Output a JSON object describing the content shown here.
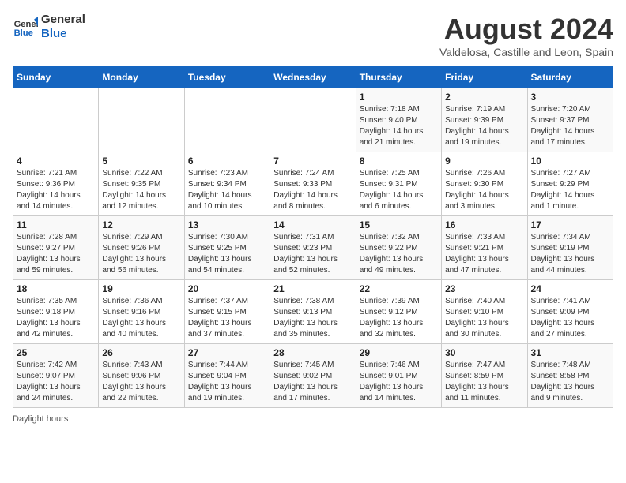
{
  "header": {
    "logo_line1": "General",
    "logo_line2": "Blue",
    "month_year": "August 2024",
    "location": "Valdelosa, Castille and Leon, Spain"
  },
  "calendar": {
    "days_of_week": [
      "Sunday",
      "Monday",
      "Tuesday",
      "Wednesday",
      "Thursday",
      "Friday",
      "Saturday"
    ],
    "weeks": [
      [
        {
          "day": "",
          "info": ""
        },
        {
          "day": "",
          "info": ""
        },
        {
          "day": "",
          "info": ""
        },
        {
          "day": "",
          "info": ""
        },
        {
          "day": "1",
          "info": "Sunrise: 7:18 AM\nSunset: 9:40 PM\nDaylight: 14 hours and 21 minutes."
        },
        {
          "day": "2",
          "info": "Sunrise: 7:19 AM\nSunset: 9:39 PM\nDaylight: 14 hours and 19 minutes."
        },
        {
          "day": "3",
          "info": "Sunrise: 7:20 AM\nSunset: 9:37 PM\nDaylight: 14 hours and 17 minutes."
        }
      ],
      [
        {
          "day": "4",
          "info": "Sunrise: 7:21 AM\nSunset: 9:36 PM\nDaylight: 14 hours and 14 minutes."
        },
        {
          "day": "5",
          "info": "Sunrise: 7:22 AM\nSunset: 9:35 PM\nDaylight: 14 hours and 12 minutes."
        },
        {
          "day": "6",
          "info": "Sunrise: 7:23 AM\nSunset: 9:34 PM\nDaylight: 14 hours and 10 minutes."
        },
        {
          "day": "7",
          "info": "Sunrise: 7:24 AM\nSunset: 9:33 PM\nDaylight: 14 hours and 8 minutes."
        },
        {
          "day": "8",
          "info": "Sunrise: 7:25 AM\nSunset: 9:31 PM\nDaylight: 14 hours and 6 minutes."
        },
        {
          "day": "9",
          "info": "Sunrise: 7:26 AM\nSunset: 9:30 PM\nDaylight: 14 hours and 3 minutes."
        },
        {
          "day": "10",
          "info": "Sunrise: 7:27 AM\nSunset: 9:29 PM\nDaylight: 14 hours and 1 minute."
        }
      ],
      [
        {
          "day": "11",
          "info": "Sunrise: 7:28 AM\nSunset: 9:27 PM\nDaylight: 13 hours and 59 minutes."
        },
        {
          "day": "12",
          "info": "Sunrise: 7:29 AM\nSunset: 9:26 PM\nDaylight: 13 hours and 56 minutes."
        },
        {
          "day": "13",
          "info": "Sunrise: 7:30 AM\nSunset: 9:25 PM\nDaylight: 13 hours and 54 minutes."
        },
        {
          "day": "14",
          "info": "Sunrise: 7:31 AM\nSunset: 9:23 PM\nDaylight: 13 hours and 52 minutes."
        },
        {
          "day": "15",
          "info": "Sunrise: 7:32 AM\nSunset: 9:22 PM\nDaylight: 13 hours and 49 minutes."
        },
        {
          "day": "16",
          "info": "Sunrise: 7:33 AM\nSunset: 9:21 PM\nDaylight: 13 hours and 47 minutes."
        },
        {
          "day": "17",
          "info": "Sunrise: 7:34 AM\nSunset: 9:19 PM\nDaylight: 13 hours and 44 minutes."
        }
      ],
      [
        {
          "day": "18",
          "info": "Sunrise: 7:35 AM\nSunset: 9:18 PM\nDaylight: 13 hours and 42 minutes."
        },
        {
          "day": "19",
          "info": "Sunrise: 7:36 AM\nSunset: 9:16 PM\nDaylight: 13 hours and 40 minutes."
        },
        {
          "day": "20",
          "info": "Sunrise: 7:37 AM\nSunset: 9:15 PM\nDaylight: 13 hours and 37 minutes."
        },
        {
          "day": "21",
          "info": "Sunrise: 7:38 AM\nSunset: 9:13 PM\nDaylight: 13 hours and 35 minutes."
        },
        {
          "day": "22",
          "info": "Sunrise: 7:39 AM\nSunset: 9:12 PM\nDaylight: 13 hours and 32 minutes."
        },
        {
          "day": "23",
          "info": "Sunrise: 7:40 AM\nSunset: 9:10 PM\nDaylight: 13 hours and 30 minutes."
        },
        {
          "day": "24",
          "info": "Sunrise: 7:41 AM\nSunset: 9:09 PM\nDaylight: 13 hours and 27 minutes."
        }
      ],
      [
        {
          "day": "25",
          "info": "Sunrise: 7:42 AM\nSunset: 9:07 PM\nDaylight: 13 hours and 24 minutes."
        },
        {
          "day": "26",
          "info": "Sunrise: 7:43 AM\nSunset: 9:06 PM\nDaylight: 13 hours and 22 minutes."
        },
        {
          "day": "27",
          "info": "Sunrise: 7:44 AM\nSunset: 9:04 PM\nDaylight: 13 hours and 19 minutes."
        },
        {
          "day": "28",
          "info": "Sunrise: 7:45 AM\nSunset: 9:02 PM\nDaylight: 13 hours and 17 minutes."
        },
        {
          "day": "29",
          "info": "Sunrise: 7:46 AM\nSunset: 9:01 PM\nDaylight: 13 hours and 14 minutes."
        },
        {
          "day": "30",
          "info": "Sunrise: 7:47 AM\nSunset: 8:59 PM\nDaylight: 13 hours and 11 minutes."
        },
        {
          "day": "31",
          "info": "Sunrise: 7:48 AM\nSunset: 8:58 PM\nDaylight: 13 hours and 9 minutes."
        }
      ]
    ]
  },
  "footer": {
    "daylight_label": "Daylight hours"
  }
}
